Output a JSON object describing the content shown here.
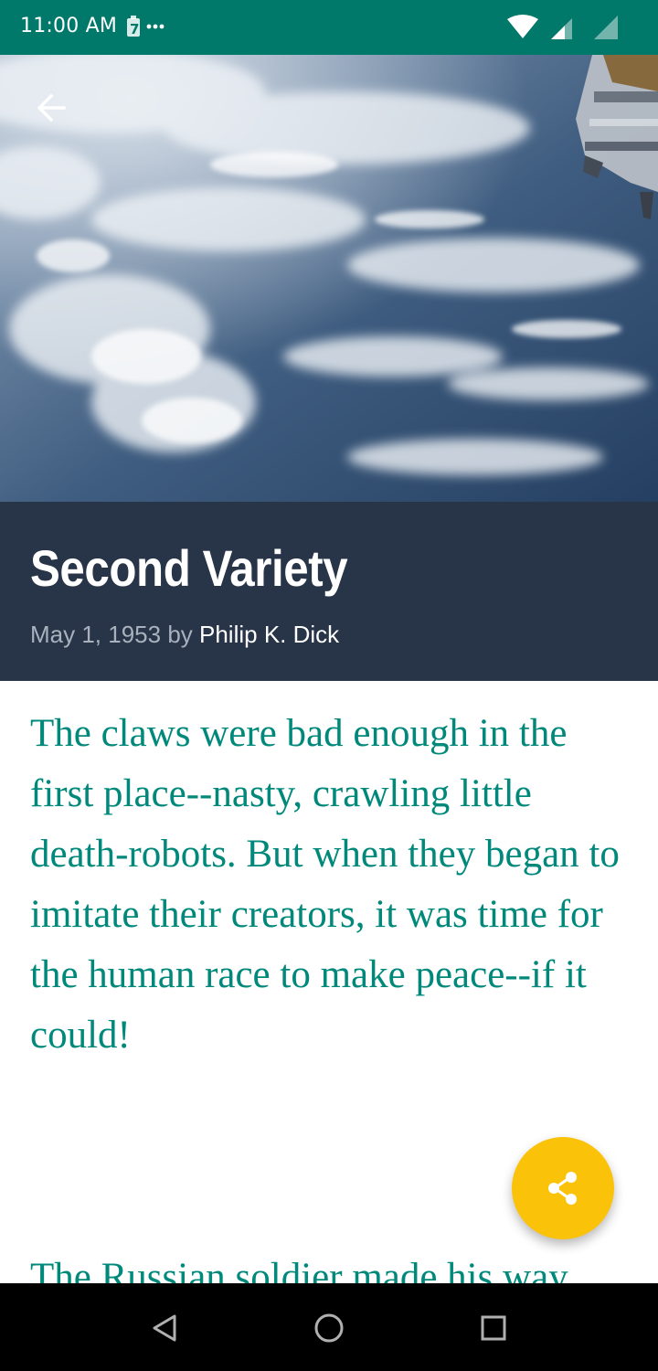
{
  "status_bar": {
    "time": "11:00 AM",
    "notification_count": "7",
    "icons": [
      "battery-icon",
      "more-notifications-icon",
      "wifi-icon",
      "signal-icon",
      "signal-icon"
    ]
  },
  "hero": {
    "icon": "back-arrow-icon"
  },
  "article": {
    "title": "Second Variety",
    "date_prefix": "May 1, 1953 by ",
    "author": "Philip K. Dick",
    "paragraphs": [
      "The claws were bad enough in the first place--nasty, crawling little death-robots. But when they began to imitate their creators, it was time for the human race to make peace--if it could!",
      "The Russian soldier made his way"
    ]
  },
  "fab": {
    "icon": "share-icon"
  },
  "nav_bar": {
    "icons": [
      "back-triangle-icon",
      "home-circle-icon",
      "recents-square-icon"
    ]
  },
  "colors": {
    "status_bar": "#00796b",
    "title_block": "#283447",
    "body_text": "#00897b",
    "fab": "#fbc20a"
  }
}
